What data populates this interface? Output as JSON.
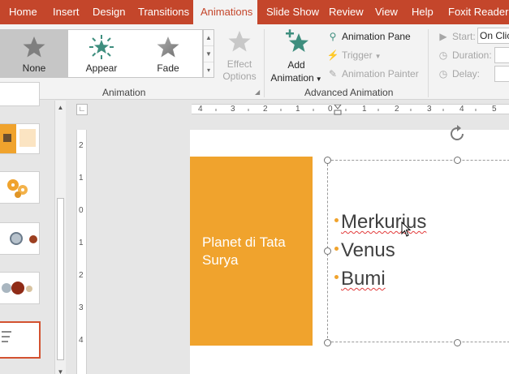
{
  "tabs": [
    {
      "label": "Home",
      "active": false
    },
    {
      "label": "Insert",
      "active": false
    },
    {
      "label": "Design",
      "active": false
    },
    {
      "label": "Transitions",
      "active": false
    },
    {
      "label": "Animations",
      "active": true
    },
    {
      "label": "Slide Show",
      "active": false
    },
    {
      "label": "Review",
      "active": false
    },
    {
      "label": "View",
      "active": false
    },
    {
      "label": "Help",
      "active": false
    },
    {
      "label": "Foxit Reader P",
      "active": false
    }
  ],
  "ribbon": {
    "animation_gallery": [
      {
        "label": "None",
        "icon": "star-gray-icon",
        "selected": true
      },
      {
        "label": "Appear",
        "icon": "star-burst-icon",
        "selected": false
      },
      {
        "label": "Fade",
        "icon": "star-fade-icon",
        "selected": false
      }
    ],
    "effect_options": {
      "line1": "Effect",
      "line2": "Options",
      "enabled": false
    },
    "animation_group_label": "Animation",
    "add_animation": {
      "line1": "Add",
      "line2": "Animation"
    },
    "animation_pane": "Animation Pane",
    "trigger": "Trigger",
    "animation_painter": "Animation Painter",
    "advanced_group_label": "Advanced Animation",
    "timing": {
      "start_label": "Start:",
      "start_value": "On Clic",
      "duration_label": "Duration:",
      "delay_label": "Delay:"
    },
    "colors": {
      "tab_bar": "#c4462b",
      "accent_green": "#3e8e7e"
    }
  },
  "rulers": {
    "horizontal": [
      "4",
      "3",
      "2",
      "1",
      "0",
      "1",
      "2",
      "3",
      "4",
      "5"
    ],
    "vertical": [
      "2",
      "1",
      "0",
      "1",
      "2",
      "3",
      "4"
    ]
  },
  "slide": {
    "title": "Planet di Tata Surya",
    "bullets": [
      "Merkurius",
      "Venus",
      "Bumi"
    ],
    "colors": {
      "title_fill": "#f0a32d",
      "bullet": "#f0a32d"
    }
  },
  "thumbnails": [
    {
      "kind": "blank"
    },
    {
      "kind": "chart-orange"
    },
    {
      "kind": "orange-gears"
    },
    {
      "kind": "planets-1"
    },
    {
      "kind": "planets-2"
    },
    {
      "kind": "bullet-text",
      "selected": true
    }
  ]
}
